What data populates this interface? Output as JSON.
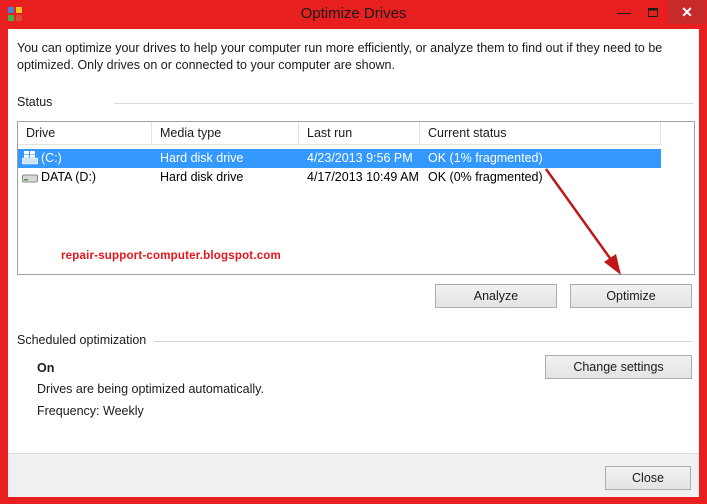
{
  "window": {
    "title": "Optimize Drives"
  },
  "description": "You can optimize your drives to help your computer run more efficiently, or analyze them to find out if they need to be optimized. Only drives on or connected to your computer are shown.",
  "status": {
    "label": "Status",
    "columns": [
      "Drive",
      "Media type",
      "Last run",
      "Current status"
    ],
    "rows": [
      {
        "drive": "(C:)",
        "media_type": "Hard disk drive",
        "last_run": "4/23/2013 9:56 PM",
        "current_status": "OK (1% fragmented)",
        "icon": "windows-drive-icon",
        "selected": true
      },
      {
        "drive": "DATA (D:)",
        "media_type": "Hard disk drive",
        "last_run": "4/17/2013 10:49 AM",
        "current_status": "OK (0% fragmented)",
        "icon": "hard-drive-icon",
        "selected": false
      }
    ],
    "watermark": "repair-support-computer.blogspot.com"
  },
  "buttons": {
    "analyze": "Analyze",
    "optimize": "Optimize",
    "change_settings": "Change settings",
    "close": "Close"
  },
  "scheduled": {
    "label": "Scheduled optimization",
    "state": "On",
    "info": "Drives are being optimized automatically.",
    "frequency": "Frequency: Weekly"
  },
  "colors": {
    "accent_frame": "#e81f1f",
    "selection": "#3399ff",
    "annotation_arrow": "#c0181a"
  }
}
